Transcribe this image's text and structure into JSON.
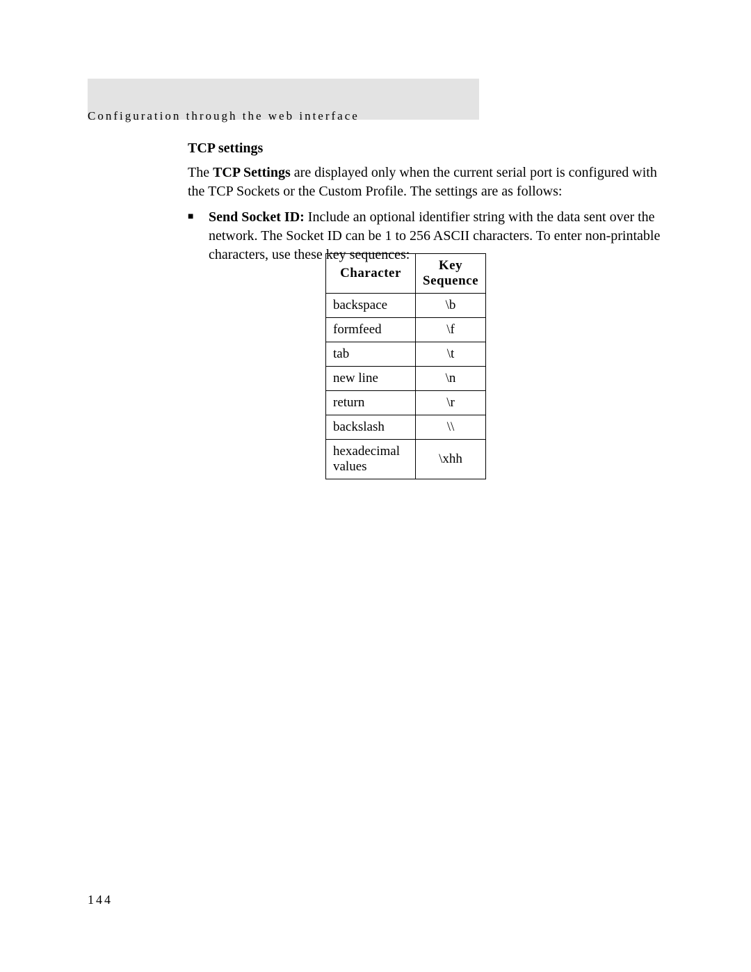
{
  "header": "Configuration through the web interface",
  "section_title": "TCP settings",
  "intro": {
    "pre": "The ",
    "bold": "TCP Settings",
    "post": " are displayed only when the current serial port is configured with the TCP Sockets or the Custom Profile. The settings are as follows:"
  },
  "bullet": {
    "glyph": "■",
    "label": "Send Socket ID:",
    "text": " Include an optional identifier string with the data sent over the network. The Socket ID can be 1 to 256 ASCII characters. To enter non-printable characters, use these key sequences:"
  },
  "table": {
    "headers": {
      "col1": "Character",
      "col2": "Key Sequence"
    },
    "rows": [
      {
        "char": "backspace",
        "seq": "\\b"
      },
      {
        "char": "formfeed",
        "seq": "\\f"
      },
      {
        "char": "tab",
        "seq": "\\t"
      },
      {
        "char": "new line",
        "seq": "\\n"
      },
      {
        "char": "return",
        "seq": "\\r"
      },
      {
        "char": "backslash",
        "seq": "\\\\"
      },
      {
        "char": "hexadecimal values",
        "seq": "\\xhh"
      }
    ]
  },
  "page_number": "144"
}
